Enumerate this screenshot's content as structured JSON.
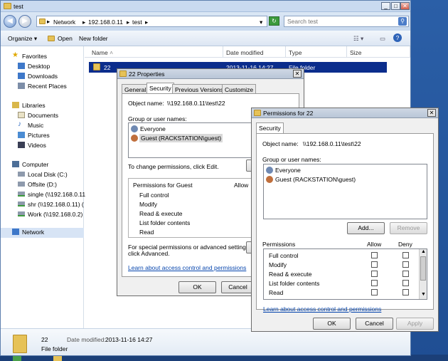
{
  "explorer": {
    "title": "test",
    "address": [
      "Network",
      "192.168.0.11",
      "test"
    ],
    "search_placeholder": "Search test",
    "toolbar": {
      "organize": "Organize",
      "open": "Open",
      "new_folder": "New folder"
    },
    "nav": {
      "favorites": "Favorites",
      "fav_items": [
        "Desktop",
        "Downloads",
        "Recent Places"
      ],
      "libraries": "Libraries",
      "lib_items": [
        "Documents",
        "Music",
        "Pictures",
        "Videos"
      ],
      "computer": "Computer",
      "comp_items": [
        "Local Disk (C:)",
        "Offsite (D:)",
        "single (\\\\192.168.0.11",
        "shr (\\\\192.168.0.11) (",
        "Work (\\\\192.168.0.2)"
      ],
      "network": "Network"
    },
    "columns": [
      "Name",
      "Date modified",
      "Type",
      "Size"
    ],
    "rows": [
      {
        "name": "22",
        "date": "2013-11-16 14:27",
        "type": "File folder"
      }
    ],
    "details": {
      "name": "22",
      "date_label": "Date modified:",
      "date": "2013-11-16 14:27",
      "type": "File folder"
    }
  },
  "properties": {
    "title": "22 Properties",
    "tabs": [
      "General",
      "Security",
      "Previous Versions",
      "Customize"
    ],
    "object_label": "Object name:",
    "object_value": "\\\\192.168.0.11\\test\\22",
    "group_label": "Group or user names:",
    "users": [
      "Everyone",
      "Guest (RACKSTATION\\guest)"
    ],
    "change_text": "To change permissions, click Edit.",
    "perms_for": "Permissions for Guest",
    "allow": "Allow",
    "perms": [
      "Full control",
      "Modify",
      "Read & execute",
      "List folder contents",
      "Read"
    ],
    "special_text": [
      "For special permissions or advanced settings,",
      "click Advanced."
    ],
    "learn_link": "Learn about access control and permissions",
    "ok": "OK",
    "cancel": "Cancel"
  },
  "permissions": {
    "title": "Permissions for 22",
    "tab": "Security",
    "object_label": "Object name:",
    "object_value": "\\\\192.168.0.11\\test\\22",
    "group_label": "Group or user names:",
    "users": [
      "Everyone",
      "Guest (RACKSTATION\\guest)"
    ],
    "add": "Add...",
    "remove": "Remove",
    "perms_label": "Permissions",
    "allow": "Allow",
    "deny": "Deny",
    "perms": [
      "Full control",
      "Modify",
      "Read & execute",
      "List folder contents",
      "Read"
    ],
    "learn_link": "Learn about access control and permissions",
    "ok": "OK",
    "cancel": "Cancel",
    "apply": "Apply"
  }
}
